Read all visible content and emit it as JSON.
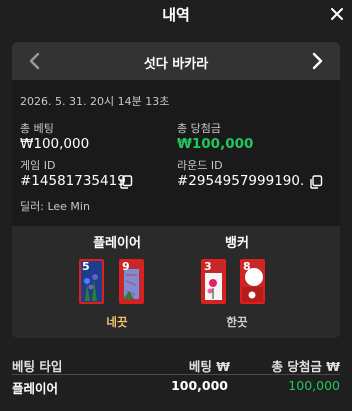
{
  "header": {
    "title": "내역"
  },
  "game": {
    "name": "섯다 바카라"
  },
  "details": {
    "datetime": "2026. 5. 31. 20시 14분 13초",
    "total_bet_label": "총 베팅",
    "total_bet_value": "₩100,000",
    "total_win_label": "총 당첨금",
    "total_win_value": "₩100,000",
    "game_id_label": "게임 ID",
    "game_id_value": "#14581735419",
    "round_id_label": "라운드 ID",
    "round_id_value": "#2954957999190...",
    "dealer": "딜러: Lee Min"
  },
  "result": {
    "player": {
      "title": "플레이어",
      "hand": "네끗",
      "cards": [
        "5",
        "9"
      ]
    },
    "banker": {
      "title": "뱅커",
      "hand": "한끗",
      "cards": [
        "3",
        "8"
      ]
    }
  },
  "table": {
    "headers": [
      "베팅 타입",
      "베팅 ₩",
      "총 당첨금 ₩"
    ],
    "rows": [
      {
        "type": "플레이어",
        "bet": "100,000",
        "win": "100,000"
      }
    ]
  },
  "colors": {
    "win_green": "#22c55e",
    "hand_gold": "#f2c46d",
    "card_border": "#e11d1d"
  },
  "icons": [
    "close-icon",
    "chevron-left-icon",
    "chevron-right-icon",
    "copy-icon"
  ]
}
